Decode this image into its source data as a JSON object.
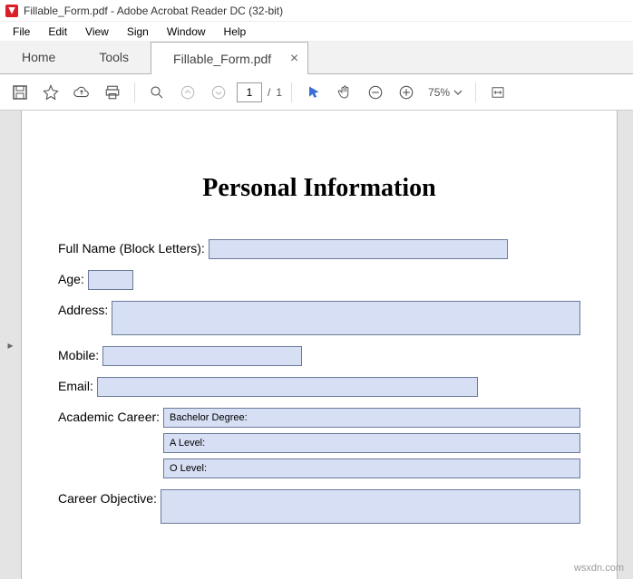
{
  "titlebar": {
    "text": "Fillable_Form.pdf - Adobe Acrobat Reader DC (32-bit)"
  },
  "menubar": {
    "file": "File",
    "edit": "Edit",
    "view": "View",
    "sign": "Sign",
    "window": "Window",
    "help": "Help"
  },
  "tabbar": {
    "home": "Home",
    "tools": "Tools",
    "doc": "Fillable_Form.pdf"
  },
  "toolbar": {
    "page_current": "1",
    "page_sep": "/",
    "page_total": "1",
    "zoom": "75%"
  },
  "form": {
    "title": "Personal Information",
    "fullname_label": "Full Name (Block Letters):",
    "age_label": "Age:",
    "address_label": "Address:",
    "mobile_label": "Mobile:",
    "email_label": "Email:",
    "academic_label": "Academic Career:",
    "academic_items": {
      "a": "Bachelor Degree:",
      "b": "A Level:",
      "c": "O Level:"
    },
    "objective_label": "Career Objective:"
  },
  "watermark": "wsxdn.com"
}
